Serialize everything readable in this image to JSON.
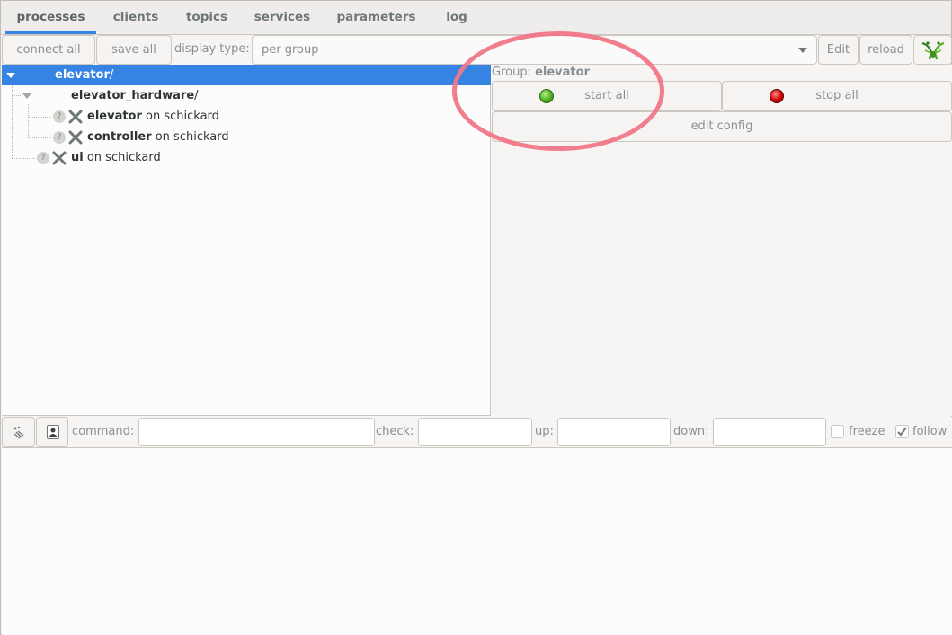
{
  "tabs": [
    {
      "label": "processes",
      "active": true
    },
    {
      "label": "clients"
    },
    {
      "label": "topics"
    },
    {
      "label": "services"
    },
    {
      "label": "parameters"
    },
    {
      "label": "log"
    }
  ],
  "toolbar": {
    "connect_all": "connect all",
    "save_all": "save all",
    "display_type_label": "display type:",
    "display_type_value": "per group",
    "edit": "Edit",
    "reload": "reload",
    "logo_icon": "mantis-logo-icon"
  },
  "tree": {
    "rows": [
      {
        "name": "elevator",
        "suffix": "/",
        "selected": true
      },
      {
        "name": "elevator_hardware",
        "suffix": "/"
      },
      {
        "name": "elevator",
        "host": " on schickard",
        "status": "unknown",
        "state": "stopped"
      },
      {
        "name": "controller",
        "host": " on schickard",
        "status": "unknown",
        "state": "stopped"
      },
      {
        "name": "ui",
        "host": " on schickard",
        "status": "unknown",
        "state": "stopped"
      }
    ]
  },
  "group_panel": {
    "group_label": "Group: ",
    "group_name": "elevator",
    "start_all": "start all",
    "stop_all": "stop all",
    "edit_config": "edit config",
    "start_color": "#4caf1e",
    "stop_color": "#cc0000"
  },
  "bottombar": {
    "command_label": "command:",
    "command_value": "",
    "check_label": "check:",
    "check_value": "",
    "up_label": "up:",
    "up_value": "",
    "down_label": "down:",
    "down_value": "",
    "freeze_label": "freeze",
    "freeze_checked": false,
    "follow_label": "follow",
    "follow_checked": true
  },
  "colors": {
    "accent": "#3584e4",
    "annotation": "#f07787"
  }
}
